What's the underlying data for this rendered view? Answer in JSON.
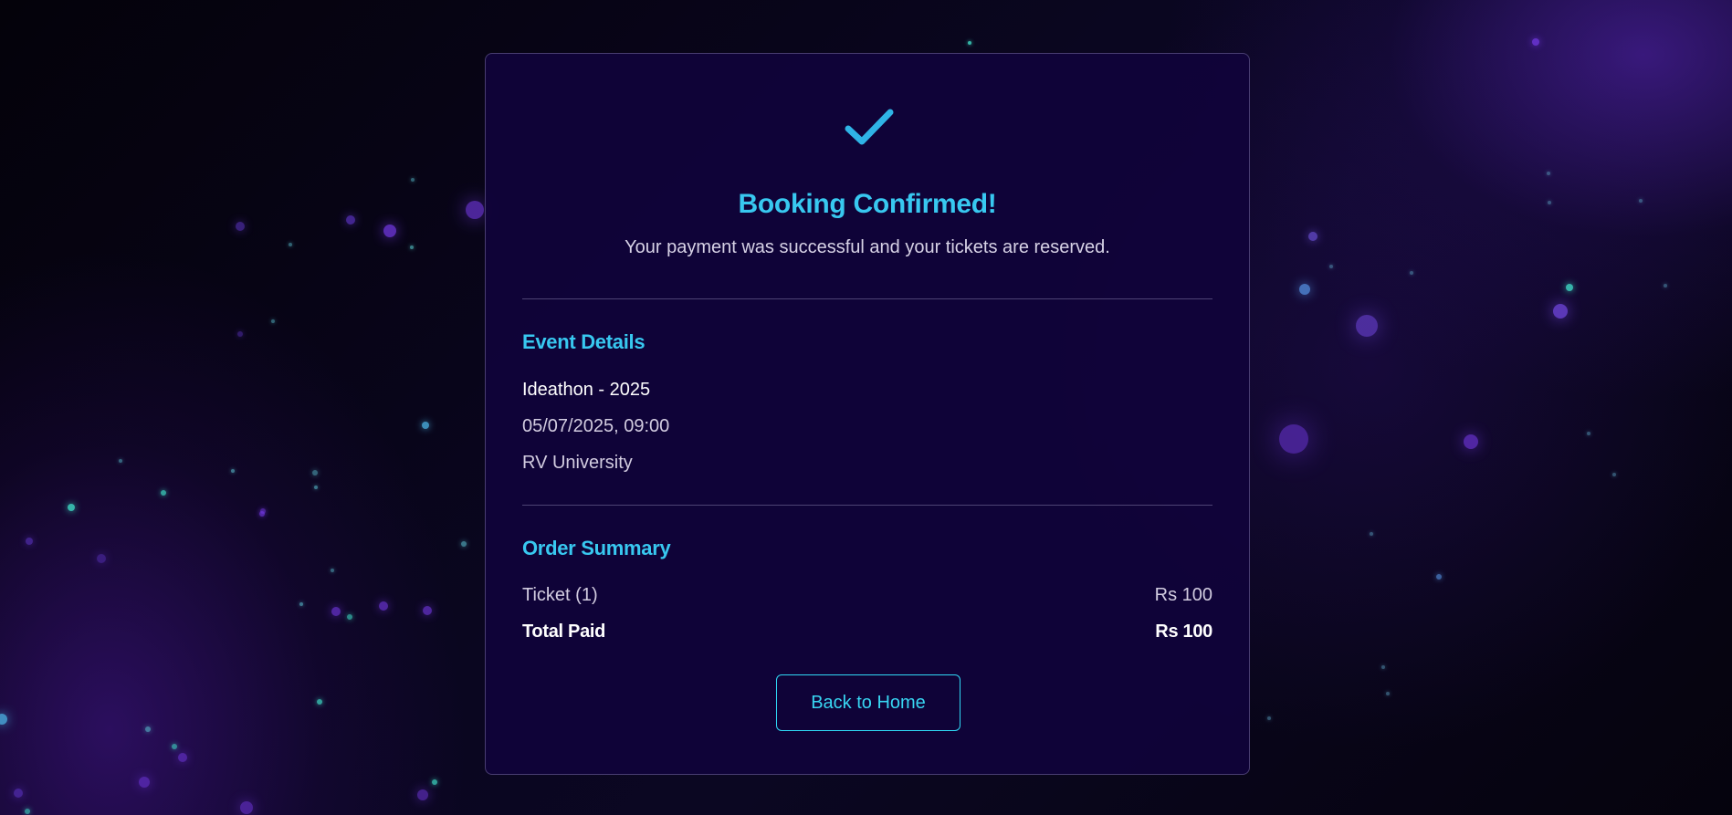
{
  "confirmation": {
    "icon": "checkmark-icon",
    "title": "Booking Confirmed!",
    "subtitle": "Your payment was successful and your tickets are reserved."
  },
  "event_details": {
    "heading": "Event Details",
    "event_name": "Ideathon - 2025",
    "date_time": "05/07/2025, 09:00",
    "venue": "RV University"
  },
  "order_summary": {
    "heading": "Order Summary",
    "ticket_label": "Ticket (1)",
    "ticket_amount": "Rs 100",
    "total_label": "Total Paid",
    "total_amount": "Rs 100"
  },
  "actions": {
    "back_home_label": "Back to Home"
  },
  "colors": {
    "accent": "#38c8f0",
    "card_background": "#10033a",
    "button_border": "#2fd9f5"
  }
}
